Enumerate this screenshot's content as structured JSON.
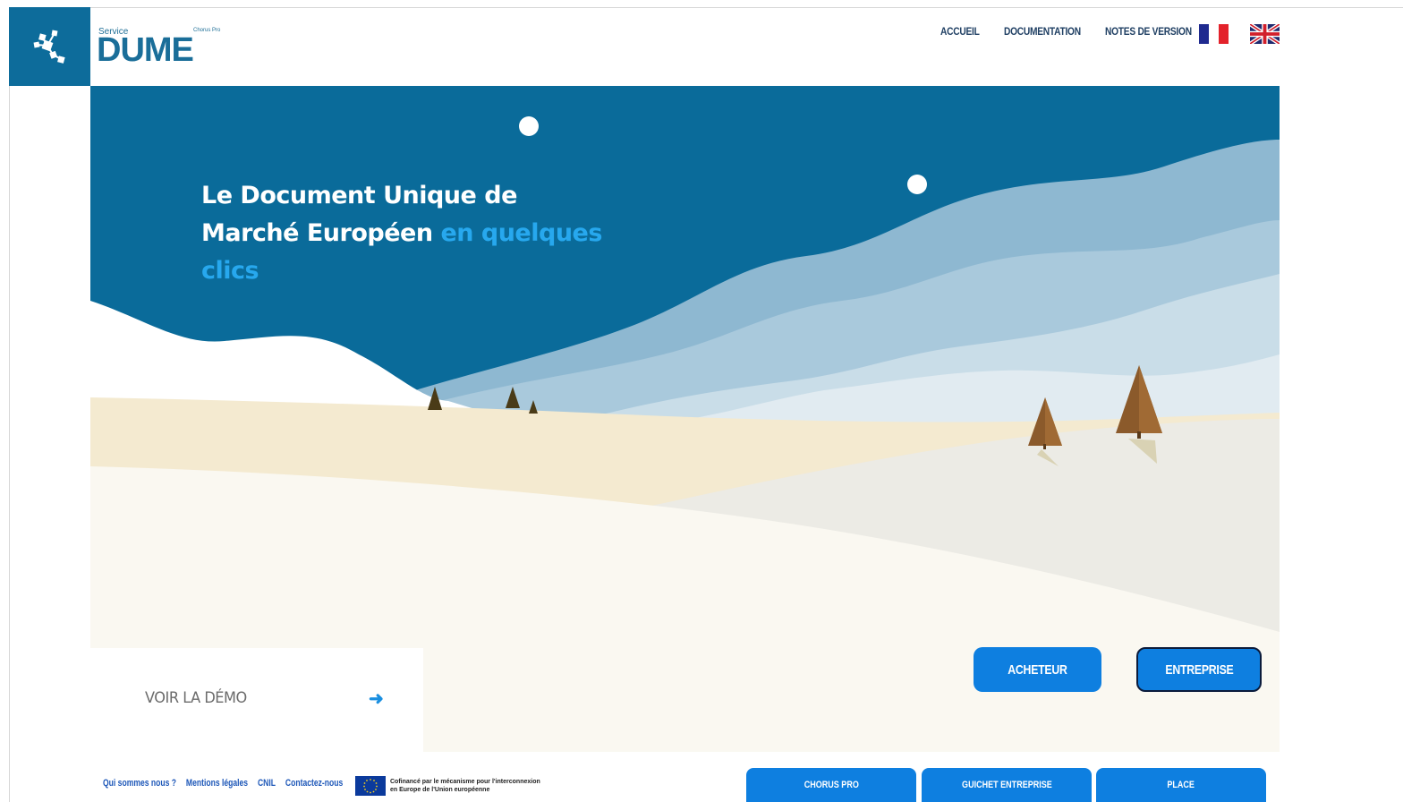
{
  "header": {
    "brand_service": "Service",
    "brand_name": "DUME",
    "brand_partner": "Chorus Pro",
    "nav": [
      {
        "label": "ACCUEIL"
      },
      {
        "label": "DOCUMENTATION"
      },
      {
        "label": "NOTES DE VERSION"
      }
    ],
    "languages": [
      "fr-flag-icon",
      "uk-flag-icon"
    ]
  },
  "hero": {
    "title_part1": "Le Document Unique de Marché Européen",
    "title_part2": "en quelques clics",
    "demo_label": "VOIR LA DÉMO",
    "demo_arrow": "➜",
    "role_buttons": [
      "ACHETEUR",
      "ENTREPRISE"
    ]
  },
  "footer": {
    "links": [
      "Qui sommes nous ?",
      "Mentions légales",
      "CNIL",
      "Contactez-nous"
    ],
    "eu_line1": "Cofinancé par le mécanisme pour l'interconnexion",
    "eu_line2": "en Europe de l'Union européenne",
    "partners": [
      "CHORUS PRO",
      "GUICHET ENTREPRISE",
      "PLACE"
    ]
  },
  "colors": {
    "primary_blue": "#0a6b9a",
    "accent_blue": "#27a8ee",
    "button_blue": "#0e7fe0",
    "nav_text": "#1f3f63"
  }
}
